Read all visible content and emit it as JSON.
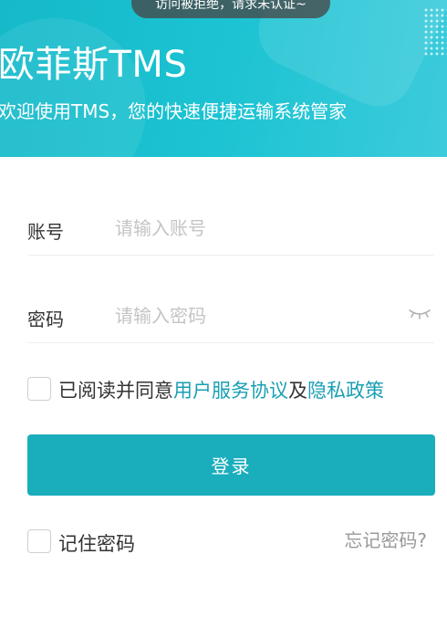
{
  "header": {
    "title": "欧菲斯TMS",
    "subtitle": "欢迎使用TMS，您的快速便捷运输系统管家"
  },
  "toast": {
    "message": "访问被拒绝，请求未认证~"
  },
  "form": {
    "account": {
      "label": "账号",
      "placeholder": "请输入账号",
      "value": ""
    },
    "password": {
      "label": "密码",
      "placeholder": "请输入密码",
      "value": "",
      "toggle_icon": "eye-closed-icon"
    },
    "agreement": {
      "checked": false,
      "prefix": "已阅读并同意",
      "user_agreement": "用户服务协议",
      "conjunction": "及",
      "privacy_policy": "隐私政策"
    },
    "login_label": "登录",
    "remember": {
      "checked": false,
      "label": "记住密码"
    },
    "forgot_label": "忘记密码?"
  },
  "colors": {
    "banner": "#1cc3d2",
    "primary_button": "#1aaebd",
    "link": "#1a9fb3",
    "placeholder": "#c4c4c4",
    "muted": "#999999"
  }
}
